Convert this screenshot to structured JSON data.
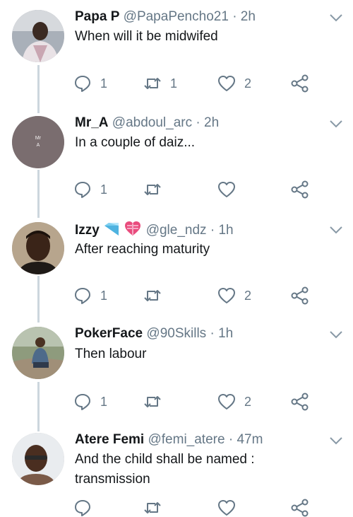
{
  "tweets": [
    {
      "name": "Papa P",
      "handle": "@PapaPencho21",
      "separator": "·",
      "time": "2h",
      "lines": [
        "When will it be midwifed"
      ],
      "replies": "1",
      "retweets": "1",
      "likes": "2",
      "avatar_icon": "photo-avatar"
    },
    {
      "name": "Mr_A",
      "handle": "@abdoul_arc",
      "separator": "·",
      "time": "2h",
      "lines": [
        "In a couple of daiz..."
      ],
      "replies": "1",
      "retweets": "",
      "likes": "",
      "avatar_text_1": "Mr",
      "avatar_text_2": "A",
      "avatar_color": "#7a6d6f"
    },
    {
      "name": "Izzy",
      "handle": "@gle_ndz",
      "separator": "·",
      "time": "1h",
      "lines": [
        "After reaching maturity"
      ],
      "replies": "1",
      "retweets": "",
      "likes": "2",
      "emojis": [
        "diamond-icon",
        "heart-ribbon-icon"
      ]
    },
    {
      "name": "PokerFace",
      "handle": "@90Skills",
      "separator": "·",
      "time": "1h",
      "lines": [
        "Then labour"
      ],
      "replies": "1",
      "retweets": "",
      "likes": "2"
    },
    {
      "name": "Atere Femi",
      "handle": "@femi_atere",
      "separator": "·",
      "time": "47m",
      "lines": [
        "And the child shall be named :",
        "transmission"
      ]
    }
  ],
  "colors": {
    "icon_gray": "#657786",
    "thread_line": "#ccd6dd",
    "name": "#14171a"
  }
}
